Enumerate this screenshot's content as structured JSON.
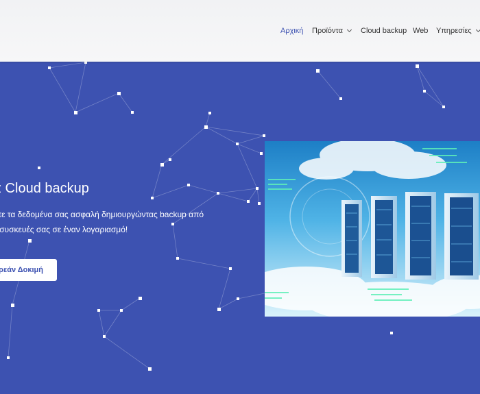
{
  "nav": {
    "items": [
      {
        "label": "Αρχική",
        "active": true
      },
      {
        "label": "Προϊόντα",
        "has_dropdown": true
      },
      {
        "label": "Cloud backup"
      },
      {
        "label": "Web"
      },
      {
        "label": "Υπηρεσίες",
        "has_dropdown": true
      }
    ]
  },
  "hero": {
    "title": "z Cloud backup",
    "description_line1": "στε τα δεδομένα σας ασφαλή  δημιουργώντας backup από",
    "description_line2": "ς συσκευές σας σε έναν λογαριασμό!",
    "cta_label": "ρεάν Δοκιμή",
    "image_label": "cloud-server-racks-image"
  },
  "colors": {
    "accent": "#3d52b1",
    "topbar": "#f4f4f5",
    "text_dark": "#333333",
    "white": "#ffffff"
  }
}
